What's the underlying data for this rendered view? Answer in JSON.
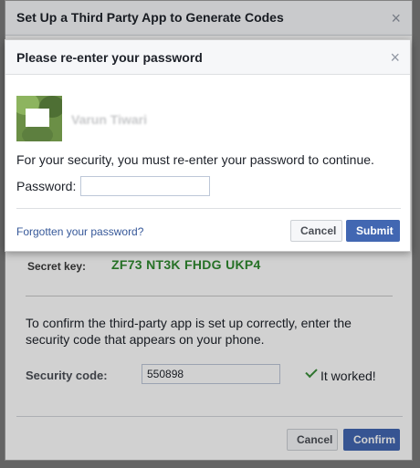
{
  "background_dialog": {
    "title": "Set Up a Third Party App to Generate Codes",
    "close_icon": "close-icon",
    "secret_key_label": "Secret key:",
    "secret_key_value": "ZF73 NT3K FHDG UKP4",
    "instructions": "To confirm the third-party app is set up correctly, enter the security code that appears on your phone.",
    "security_code_label": "Security code:",
    "security_code_value": "550898",
    "status_icon": "check-icon",
    "status_text": "It worked!",
    "cancel_label": "Cancel",
    "confirm_label": "Confirm"
  },
  "foreground_dialog": {
    "title": "Please re-enter your password",
    "close_icon": "close-icon",
    "avatar": "avatar",
    "user_name": "Varun Tiwari",
    "security_message": "For your security, you must re-enter your password to continue.",
    "password_label": "Password:",
    "password_value": "",
    "forgot_password_label": "Forgotten your password?",
    "cancel_label": "Cancel",
    "submit_label": "Submit"
  },
  "colors": {
    "accent_blue": "#4267b2",
    "success_green": "#2f8a2f",
    "link_blue": "#365899"
  }
}
